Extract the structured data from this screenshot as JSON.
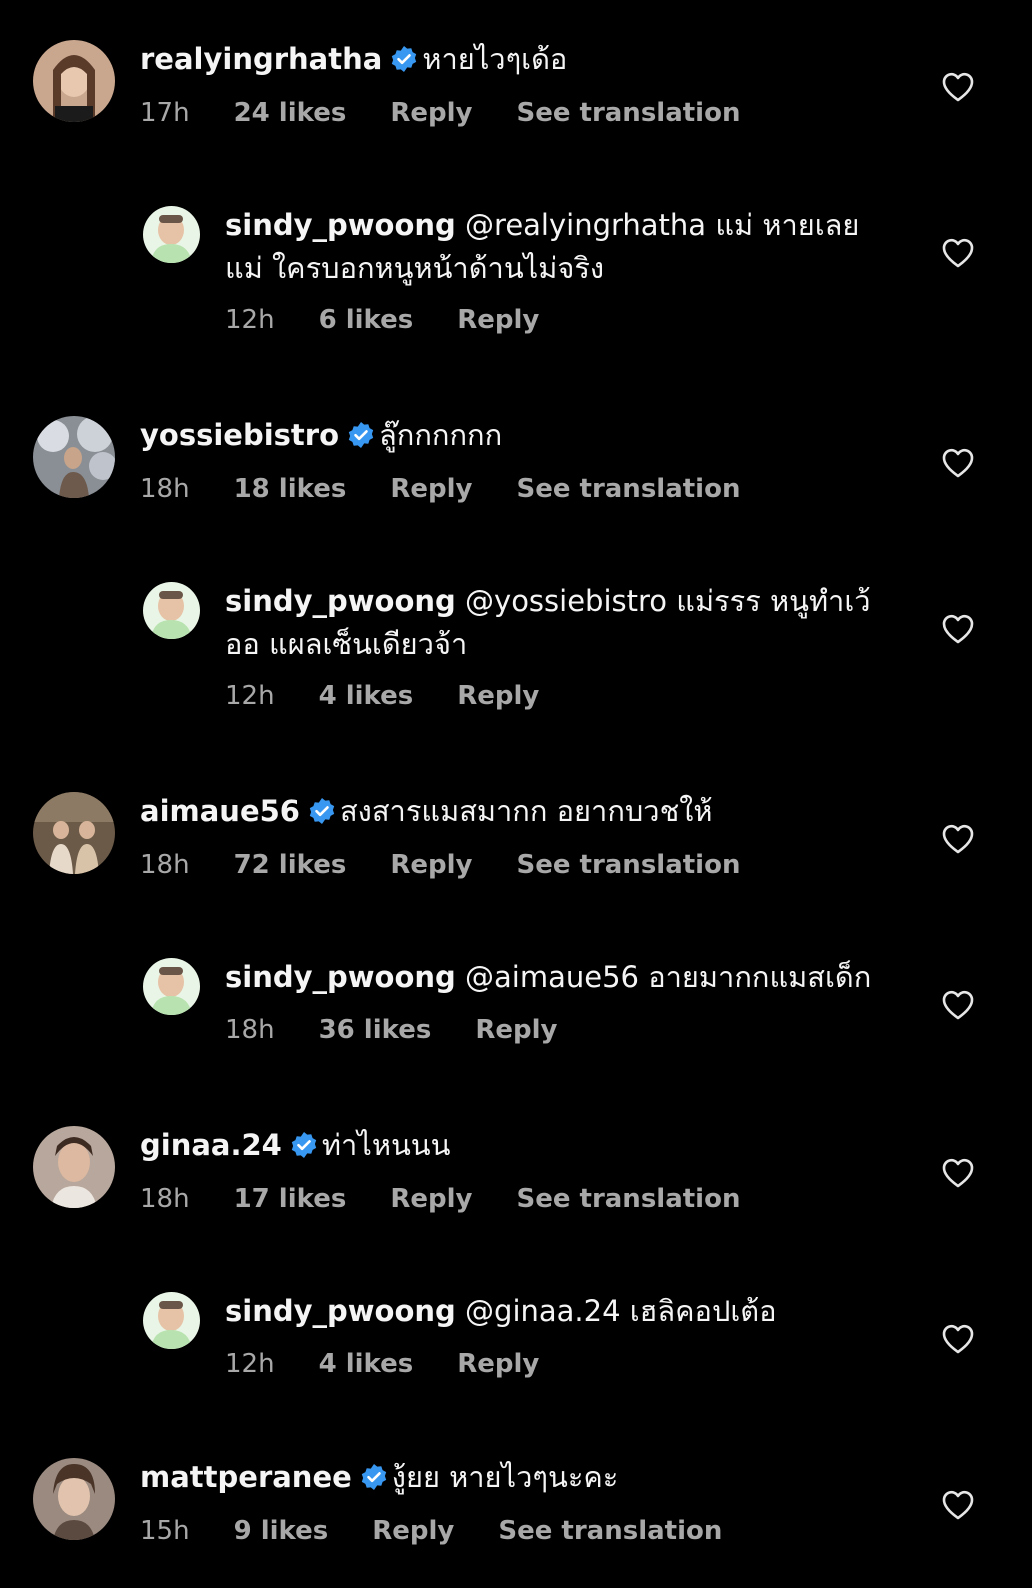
{
  "comments": [
    {
      "username": "realyingrhatha",
      "verified": true,
      "text": "หายไวๆเด้อ",
      "time": "17h",
      "likes": "24 likes",
      "reply": "Reply",
      "translate": "See translation",
      "avatar_color": "#c9a68e"
    },
    {
      "username": "sindy_pwoong",
      "mention": "@realyingrhatha",
      "text": "แม่ หายเลย แม่ ใครบอกหนูหน้าด้านไม่จริง",
      "time": "12h",
      "likes": "6 likes",
      "reply": "Reply"
    },
    {
      "username": "yossiebistro",
      "verified": true,
      "text": "ลู๊กกกกกก",
      "time": "18h",
      "likes": "18 likes",
      "reply": "Reply",
      "translate": "See translation",
      "avatar_color": "#8a8f96"
    },
    {
      "username": "sindy_pwoong",
      "mention": "@yossiebistro",
      "text": "แม่รรร หนูทำเว้ออ แผลเซ็นเดียวจ้า",
      "time": "12h",
      "likes": "4 likes",
      "reply": "Reply"
    },
    {
      "username": "aimaue56",
      "verified": true,
      "text": "สงสารแมสมากก อยากบวชให้",
      "time": "18h",
      "likes": "72 likes",
      "reply": "Reply",
      "translate": "See translation",
      "avatar_color": "#6b5a48"
    },
    {
      "username": "sindy_pwoong",
      "mention": "@aimaue56",
      "text": "อายมากกแมสเด็ก",
      "time": "18h",
      "likes": "36 likes",
      "reply": "Reply"
    },
    {
      "username": "ginaa.24",
      "verified": true,
      "text": "ท่าไหนนน",
      "time": "18h",
      "likes": "17 likes",
      "reply": "Reply",
      "translate": "See translation",
      "avatar_color": "#b8a79c"
    },
    {
      "username": "sindy_pwoong",
      "mention": "@ginaa.24",
      "text": "เฮลิคอปเต้อ",
      "time": "12h",
      "likes": "4 likes",
      "reply": "Reply"
    },
    {
      "username": "mattperanee",
      "verified": true,
      "text": "งู้ยย หายไวๆนะคะ",
      "time": "15h",
      "likes": "9 likes",
      "reply": "Reply",
      "translate": "See translation",
      "avatar_color": "#9a8a80"
    }
  ],
  "colors": {
    "background": "#000000",
    "text": "#f5f5f5",
    "meta": "#a8a8a8",
    "verified_badge": "#3897f0",
    "reply_avatar": "#e9f5e6"
  },
  "icons": {
    "like": "heart-outline-icon",
    "verified": "verified-badge-icon"
  }
}
